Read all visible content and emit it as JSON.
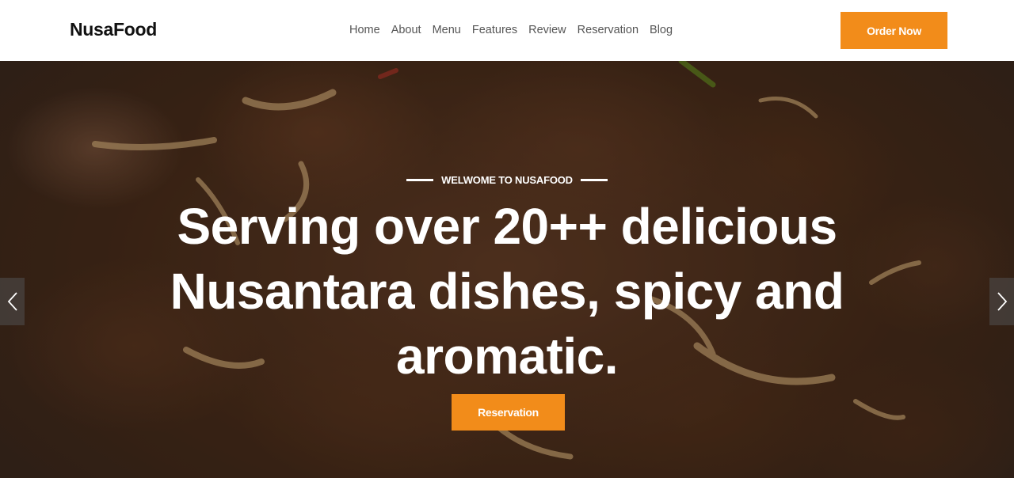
{
  "brand": {
    "name": "NusaFood"
  },
  "nav": {
    "items": [
      {
        "label": "Home"
      },
      {
        "label": "About"
      },
      {
        "label": "Menu"
      },
      {
        "label": "Features"
      },
      {
        "label": "Review"
      },
      {
        "label": "Reservation"
      },
      {
        "label": "Blog"
      }
    ],
    "cta_label": "Order Now"
  },
  "hero": {
    "eyebrow": "WELWOME TO NUSAFOOD",
    "headline": "Serving over 20++ delicious Nusantara dishes, spicy and aromatic.",
    "cta_label": "Reservation",
    "prev_icon": "chevron-left-icon",
    "next_icon": "chevron-right-icon"
  },
  "colors": {
    "accent": "#f28c1a",
    "header_bg": "#ffffff",
    "logo_text": "#111111",
    "nav_text": "#555555",
    "hero_text": "#ffffff"
  }
}
